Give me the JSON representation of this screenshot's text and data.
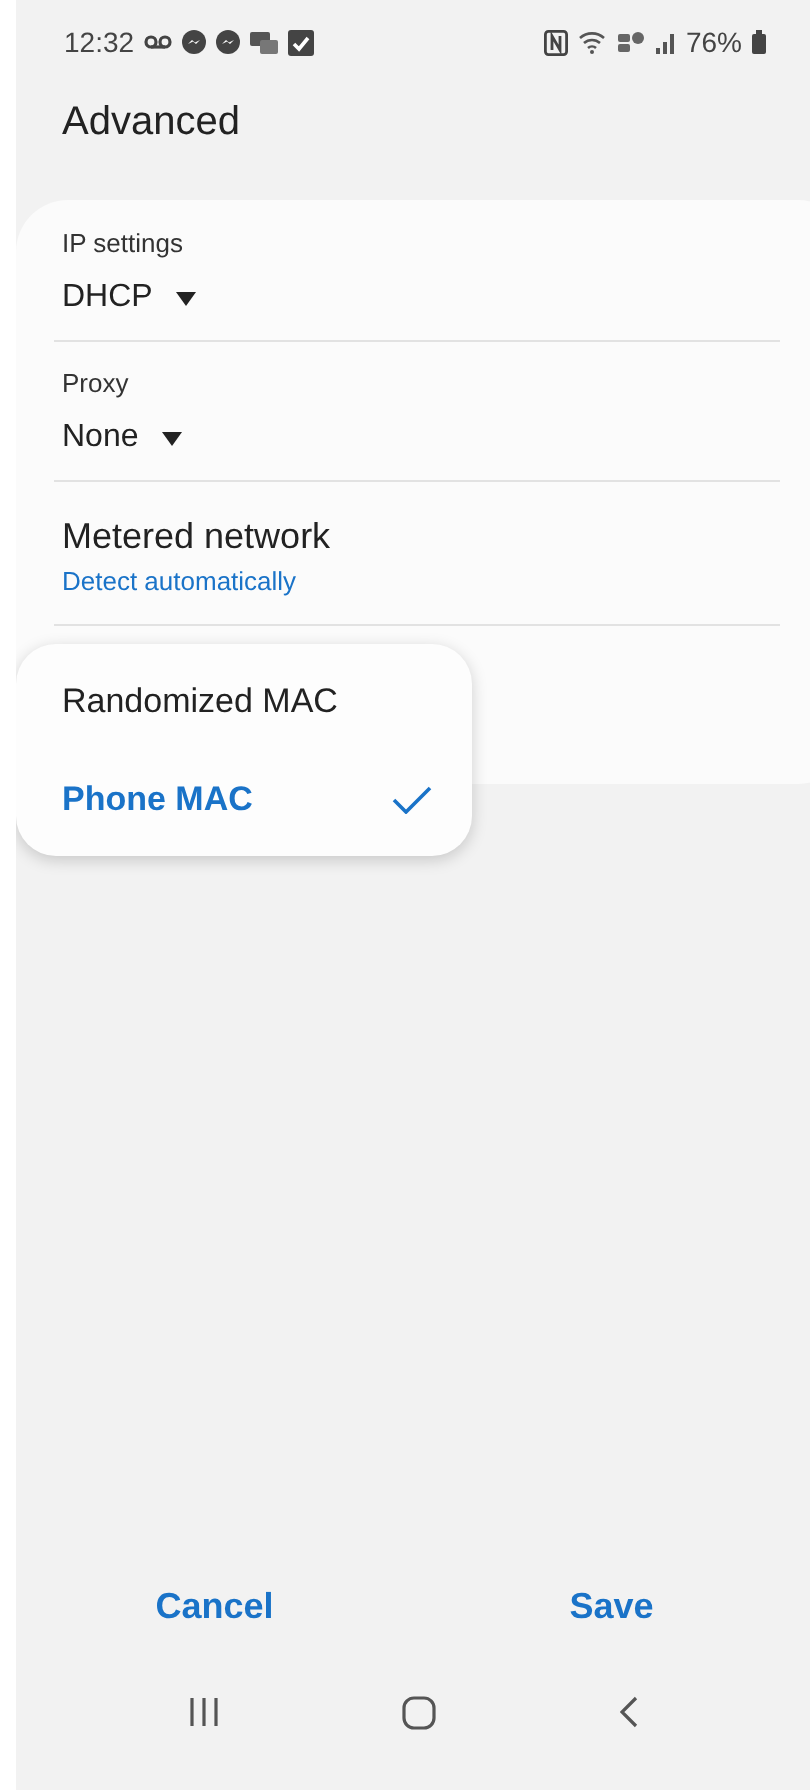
{
  "status_bar": {
    "time": "12:32",
    "battery": "76%"
  },
  "title": "Advanced",
  "settings": [
    {
      "kind": "dropdown",
      "label": "IP settings",
      "value": "DHCP"
    },
    {
      "kind": "dropdown",
      "label": "Proxy",
      "value": "None"
    },
    {
      "kind": "summary",
      "title": "Metered network",
      "summary": "Detect automatically"
    }
  ],
  "mac_menu": {
    "options": [
      {
        "label": "Randomized MAC",
        "selected": false
      },
      {
        "label": "Phone MAC",
        "selected": true
      }
    ]
  },
  "buttons": [
    {
      "label": "Cancel"
    },
    {
      "label": "Save"
    }
  ]
}
